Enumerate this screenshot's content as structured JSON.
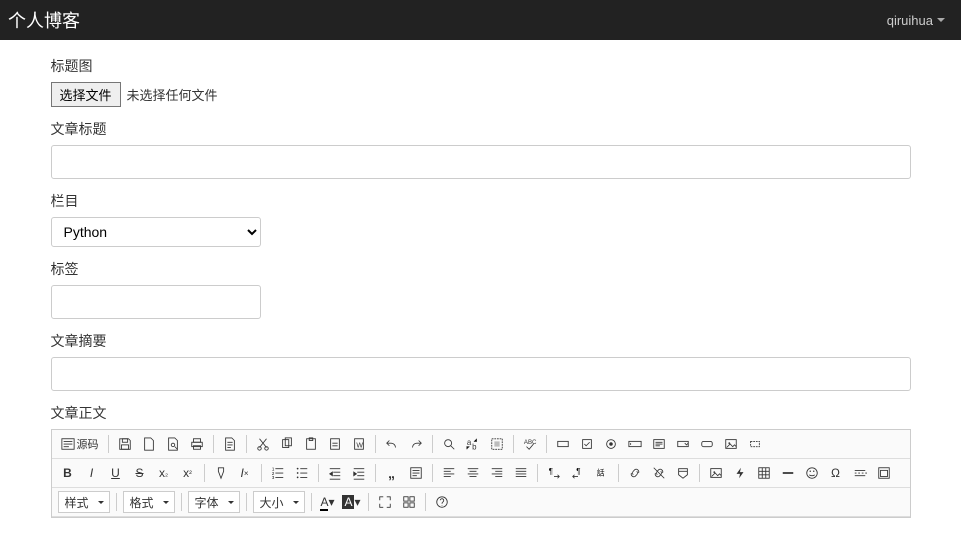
{
  "navbar": {
    "brand": "个人博客",
    "user": "qiruihua"
  },
  "form": {
    "cover": {
      "label": "标题图",
      "button": "选择文件",
      "status": "未选择任何文件"
    },
    "title": {
      "label": "文章标题",
      "value": ""
    },
    "category": {
      "label": "栏目",
      "selected": "Python"
    },
    "tags": {
      "label": "标签",
      "value": ""
    },
    "summary": {
      "label": "文章摘要",
      "value": ""
    },
    "body": {
      "label": "文章正文"
    }
  },
  "editor": {
    "source_label": "源码",
    "combos": {
      "format": "样式",
      "paragraph": "格式",
      "font": "字体",
      "size": "大小"
    }
  }
}
